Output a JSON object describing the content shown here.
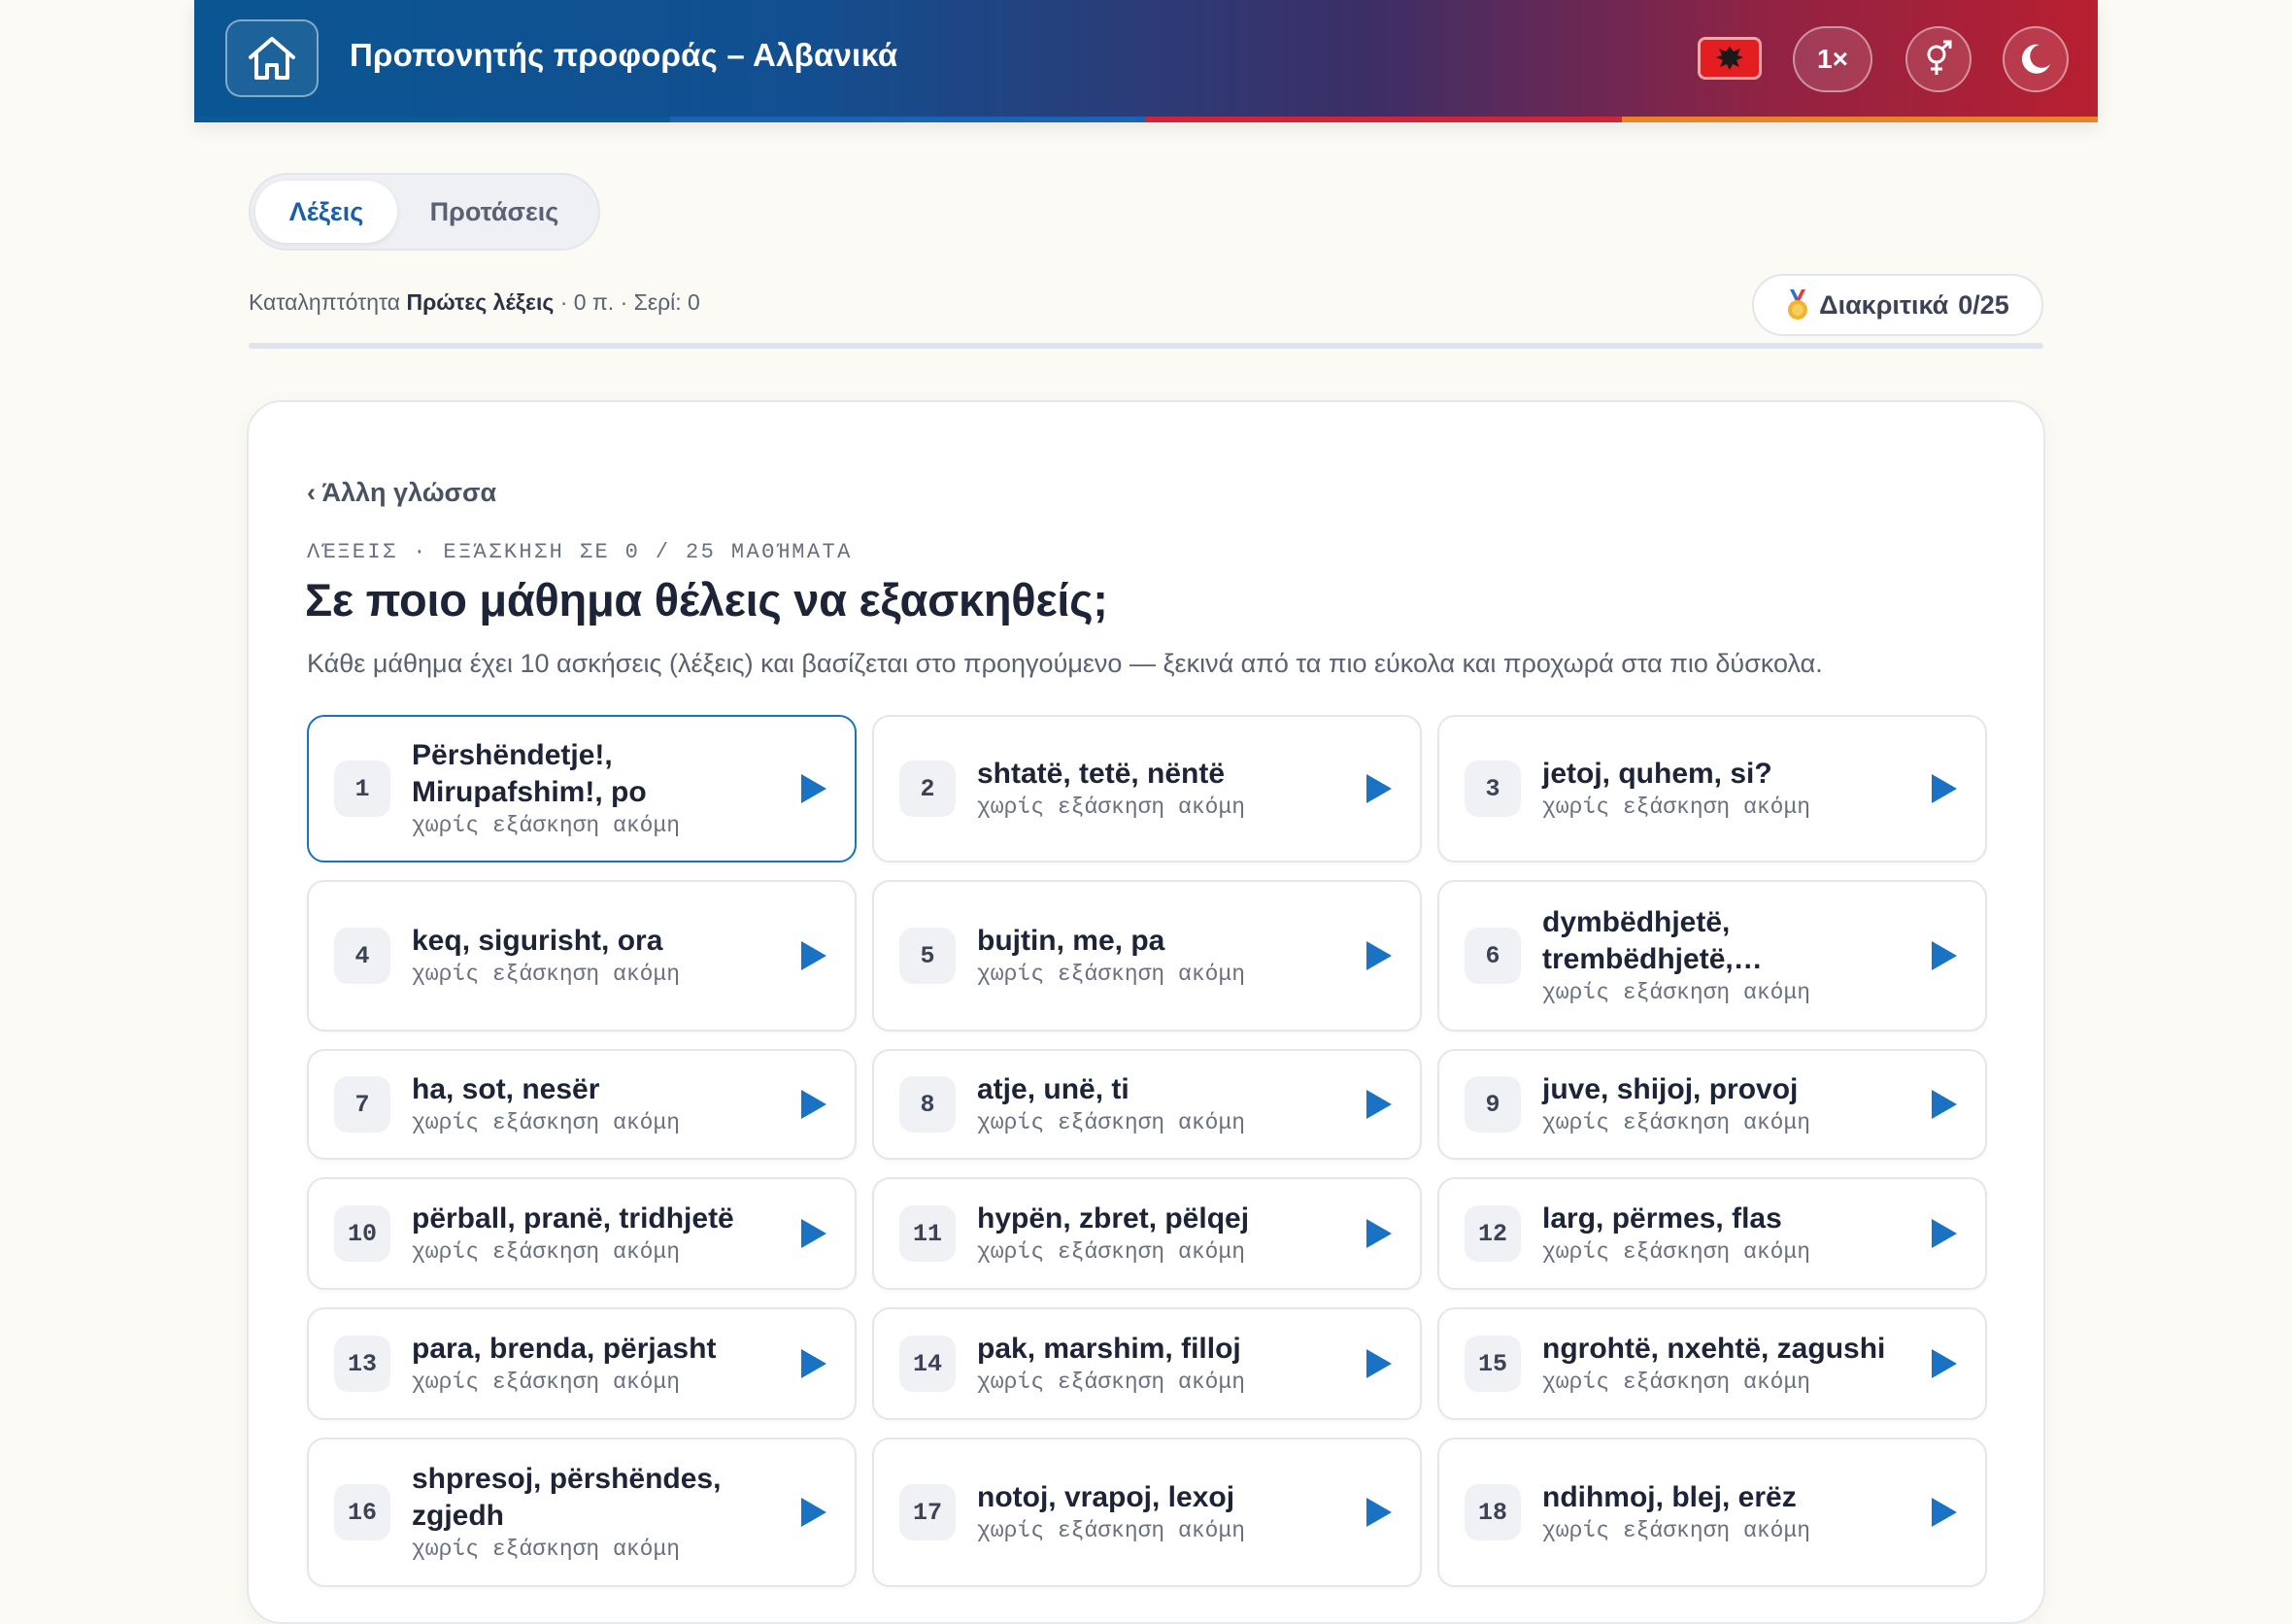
{
  "header": {
    "title": "Προπονητής προφοράς – Αλβανικά",
    "speed_label": "1×",
    "flag_icon": "albania-flag-icon",
    "gender_icon": "gender-symbol-icon",
    "theme_icon": "moon-icon"
  },
  "tabs": [
    {
      "label": "Λέξεις",
      "active": true
    },
    {
      "label": "Προτάσεις",
      "active": false
    }
  ],
  "status": {
    "prefix": "Καταληπτότητα",
    "level": "Πρώτες λέξεις",
    "suffix": "· 0 π. · Σερί: 0"
  },
  "badge": {
    "icon": "medal-icon",
    "label": "Διακριτικά",
    "count": "0/25"
  },
  "progress": {
    "fraction": 0
  },
  "main": {
    "back_label": "‹ Άλλη γλώσσα",
    "eyebrow": "ΛΈΞΕΙΣ · ΕΞΆΣΚΗΣΗ ΣΕ 0 / 25 ΜΑΘΉΜΑΤΑ",
    "heading": "Σε ποιο μάθημα θέλεις να εξασκηθείς;",
    "description": "Κάθε μάθημα έχει 10 ασκήσεις (λέξεις) και βασίζεται στο προηγούμενο — ξεκινά από τα πιο εύκολα και προχωρά στα πιο δύσκολα."
  },
  "lessons": [
    {
      "num": "1",
      "words": "Përshëndetje!, Mirupafshim!, po",
      "status": "χωρίς εξάσκηση ακόμη",
      "selected": true
    },
    {
      "num": "2",
      "words": "shtatë, tetë, nëntë",
      "status": "χωρίς εξάσκηση ακόμη"
    },
    {
      "num": "3",
      "words": "jetoj, quhem, si?",
      "status": "χωρίς εξάσκηση ακόμη"
    },
    {
      "num": "4",
      "words": "keq, sigurisht, ora",
      "status": "χωρίς εξάσκηση ακόμη"
    },
    {
      "num": "5",
      "words": "bujtin, me, pa",
      "status": "χωρίς εξάσκηση ακόμη"
    },
    {
      "num": "6",
      "words": "dymbëdhjetë, trembëdhjetë,…",
      "status": "χωρίς εξάσκηση ακόμη"
    },
    {
      "num": "7",
      "words": "ha, sot, nesër",
      "status": "χωρίς εξάσκηση ακόμη"
    },
    {
      "num": "8",
      "words": "atje, unë, ti",
      "status": "χωρίς εξάσκηση ακόμη"
    },
    {
      "num": "9",
      "words": "juve, shijoj, provoj",
      "status": "χωρίς εξάσκηση ακόμη"
    },
    {
      "num": "10",
      "words": "përball, pranë, tridhjetë",
      "status": "χωρίς εξάσκηση ακόμη"
    },
    {
      "num": "11",
      "words": "hypën, zbret, pëlqej",
      "status": "χωρίς εξάσκηση ακόμη"
    },
    {
      "num": "12",
      "words": "larg, përmes, flas",
      "status": "χωρίς εξάσκηση ακόμη"
    },
    {
      "num": "13",
      "words": "para, brenda, përjasht",
      "status": "χωρίς εξάσκηση ακόμη"
    },
    {
      "num": "14",
      "words": "pak, marshim, filloj",
      "status": "χωρίς εξάσκηση ακόμη"
    },
    {
      "num": "15",
      "words": "ngrohtë, nxehtë, zagushi",
      "status": "χωρίς εξάσκηση ακόμη"
    },
    {
      "num": "16",
      "words": "shpresoj, përshëndes, zgjedh",
      "status": "χωρίς εξάσκηση ακόμη"
    },
    {
      "num": "17",
      "words": "notoj, vrapoj, lexoj",
      "status": "χωρίς εξάσκηση ακόμη"
    },
    {
      "num": "18",
      "words": "ndihmoj, blej, erëz",
      "status": "χωρίς εξάσκηση ακόμη"
    }
  ],
  "colors": {
    "accent": "#1a72c4",
    "play": "#1a72c4",
    "stripe": [
      "#0b5a98",
      "#1a63b5",
      "#d0243a",
      "#e8832a"
    ]
  }
}
